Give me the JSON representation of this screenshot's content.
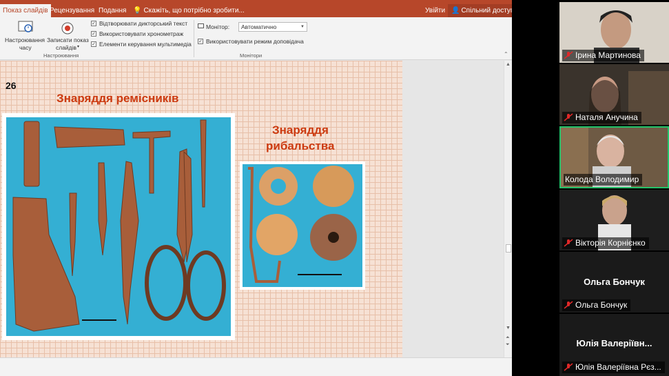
{
  "ppt": {
    "tabs": [
      "Показ слайдів",
      "Рецензування",
      "Подання"
    ],
    "search_hint": "Скажіть, що потрібно зробити...",
    "signin": "Увійти",
    "share": "Спільний доступ",
    "ribbon": {
      "timing_btn": [
        "Настроювання",
        "часу"
      ],
      "record_btn": [
        "Записати показ",
        "слайдів"
      ],
      "check_narration": "Відтворювати дикторський текст",
      "check_timings": "Використовувати хронометраж",
      "check_media": "Елементи керування мультимедіа",
      "group_setup": "Настроювання",
      "monitor_label": "Монітор:",
      "monitor_value": "Автоматично",
      "presenter_view": "Використовувати режим доповідача",
      "group_monitors": "Монітори"
    },
    "slide": {
      "number": "26",
      "title_crafts": "Знаряддя ремісників",
      "title_fishing_1": "Знаряддя",
      "title_fishing_2": "рибальства"
    }
  },
  "zoom": {
    "participants": [
      {
        "name": "Ірина Мартинова",
        "muted": true
      },
      {
        "name": "Наталя Анучина",
        "muted": true
      },
      {
        "name": "Колода Володимир",
        "muted": false,
        "active": true
      },
      {
        "name": "Вікторія Корнієнко",
        "muted": true
      },
      {
        "name": "Ольга Бончук",
        "muted": true,
        "display": "Ольга Бончук"
      },
      {
        "name": "Юлія Валеріївна Рєз...",
        "muted": true,
        "display": "Юлія Валеріївн..."
      }
    ]
  },
  "colors": {
    "ppt_accent": "#b7472a",
    "slide_title": "#cc3a10",
    "photo_bg": "#34afd3",
    "active_speaker": "#23c36a",
    "mute_red": "#e02828"
  }
}
